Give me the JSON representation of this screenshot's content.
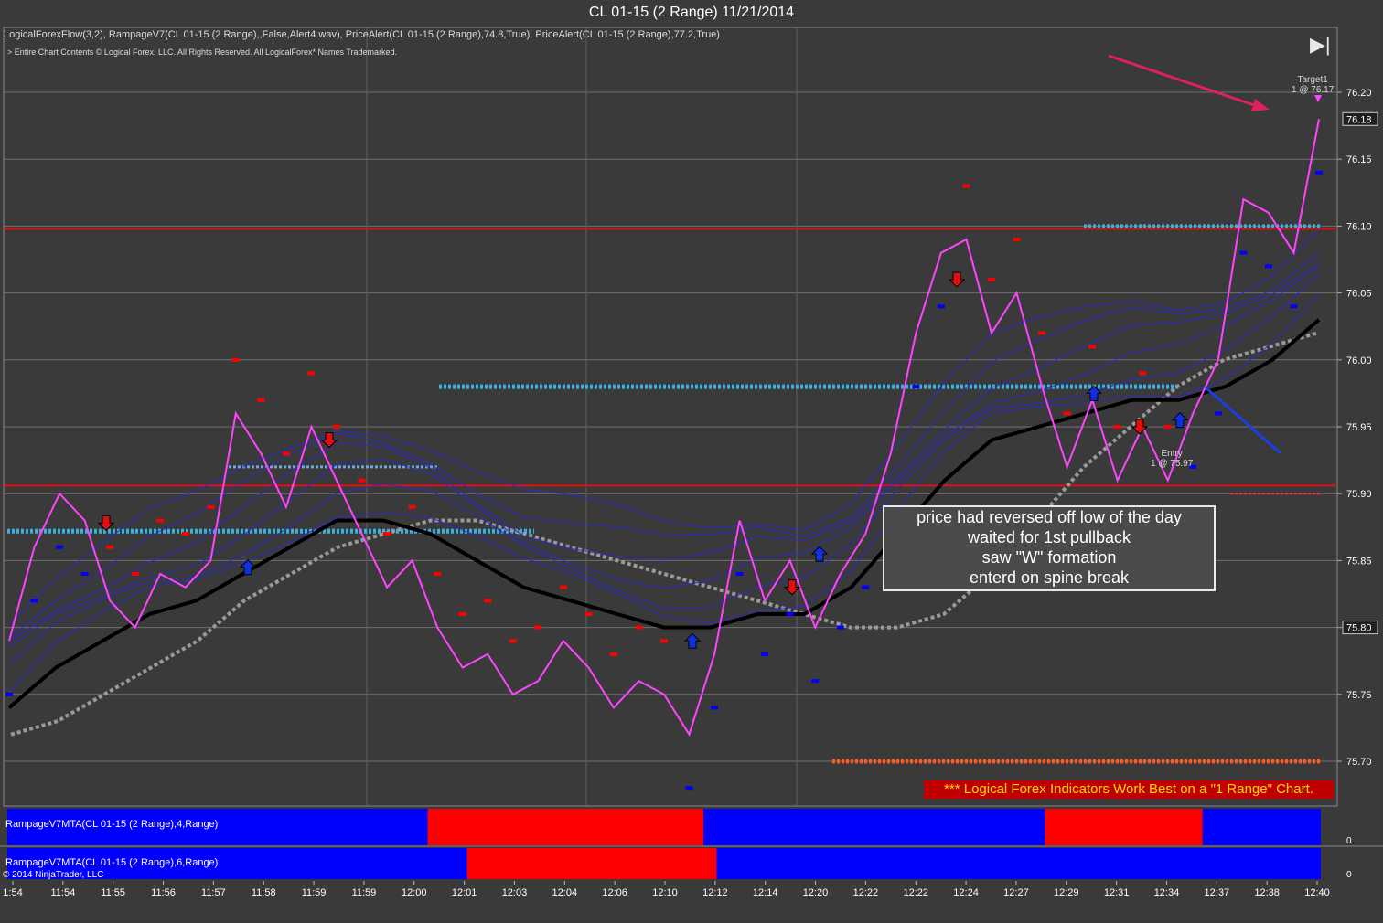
{
  "title": "CL 01-15 (2 Range)  11/21/2014",
  "indicators_line": "LogicalForexFlow(3,2),  RampageV7(CL 01-15 (2 Range),,False,Alert4.wav), PriceAlert(CL 01-15 (2 Range),74.8,True), PriceAlert(CL 01-15 (2 Range),77.2,True)",
  "copyright_line": "> Entire Chart Contents © Logical Forex, LLC. All Rights Reserved. All LogicalForex* Names Trademarked.",
  "note": [
    "price had reversed off low of the day",
    "waited for 1st pullback",
    "saw \"W\" formation",
    "enterd on spine break"
  ],
  "promo": "*** Logical Forex Indicators Work Best on a \"1 Range\" Chart.",
  "target": {
    "line1": "Target1",
    "line2": "1 @ 76.17"
  },
  "entry": {
    "line1": "Entry",
    "line2": "1 @ 75.97"
  },
  "mta1_label": "RampageV7MTA(CL 01-15 (2 Range),4,Range)",
  "mta2_label": "RampageV7MTA(CL 01-15 (2 Range),6,Range)",
  "ninja_copyright": "© 2014 NinjaTrader, LLC",
  "colors": {
    "price": "#ff44ff",
    "spine": "#000000",
    "up": "#0000ff",
    "down": "#ff0000",
    "level": "#3ab0e0",
    "background": "#3a3a3a"
  },
  "chart_data": {
    "type": "line",
    "ylim": [
      75.67,
      76.22
    ],
    "ytick_labels": [
      "76.20",
      "76.15",
      "76.10",
      "76.05",
      "76.00",
      "75.95",
      "75.90",
      "75.85",
      "75.80",
      "75.75",
      "75.70"
    ],
    "y_ticks": [
      76.2,
      76.15,
      76.1,
      76.05,
      76.0,
      75.95,
      75.9,
      75.85,
      75.8,
      75.75,
      75.7
    ],
    "current_price_labels": [
      "76.18",
      "75.80"
    ],
    "current_price_values": [
      76.18,
      75.8
    ],
    "x_labels": [
      "1:54",
      "11:54",
      "11:55",
      "11:56",
      "11:57",
      "11:58",
      "11:59",
      "11:59",
      "12:00",
      "12:01",
      "12:03",
      "12:04",
      "12:06",
      "12:10",
      "12:12",
      "12:14",
      "12:20",
      "12:22",
      "12:22",
      "12:24",
      "12:27",
      "12:29",
      "12:31",
      "12:34",
      "12:37",
      "12:38",
      "12:40"
    ],
    "price": [
      75.79,
      75.86,
      75.9,
      75.88,
      75.82,
      75.8,
      75.84,
      75.83,
      75.85,
      75.96,
      75.93,
      75.89,
      75.95,
      75.91,
      75.87,
      75.83,
      75.85,
      75.8,
      75.77,
      75.78,
      75.75,
      75.76,
      75.79,
      75.77,
      75.74,
      75.76,
      75.75,
      75.72,
      75.78,
      75.88,
      75.82,
      75.85,
      75.8,
      75.84,
      75.87,
      75.93,
      76.02,
      76.08,
      76.09,
      76.02,
      76.05,
      75.98,
      75.92,
      75.97,
      75.91,
      75.95,
      75.91,
      75.96,
      76.0,
      76.12,
      76.11,
      76.08,
      76.18
    ],
    "spine": [
      75.74,
      75.77,
      75.79,
      75.81,
      75.82,
      75.84,
      75.86,
      75.88,
      75.88,
      75.87,
      75.85,
      75.83,
      75.82,
      75.81,
      75.8,
      75.8,
      75.81,
      75.81,
      75.83,
      75.87,
      75.91,
      75.94,
      75.95,
      75.96,
      75.97,
      75.97,
      75.98,
      76.0,
      76.03
    ],
    "mta1": [
      {
        "from": 0,
        "to": 0.32,
        "state": "up"
      },
      {
        "from": 0.32,
        "to": 0.53,
        "state": "down"
      },
      {
        "from": 0.53,
        "to": 0.79,
        "state": "up"
      },
      {
        "from": 0.79,
        "to": 0.91,
        "state": "down"
      },
      {
        "from": 0.91,
        "to": 1.0,
        "state": "up"
      }
    ],
    "mta2": [
      {
        "from": 0,
        "to": 0.35,
        "state": "up"
      },
      {
        "from": 0.35,
        "to": 0.54,
        "state": "down"
      },
      {
        "from": 0.54,
        "to": 1.0,
        "state": "up"
      }
    ],
    "mta_axis_label": "0"
  }
}
